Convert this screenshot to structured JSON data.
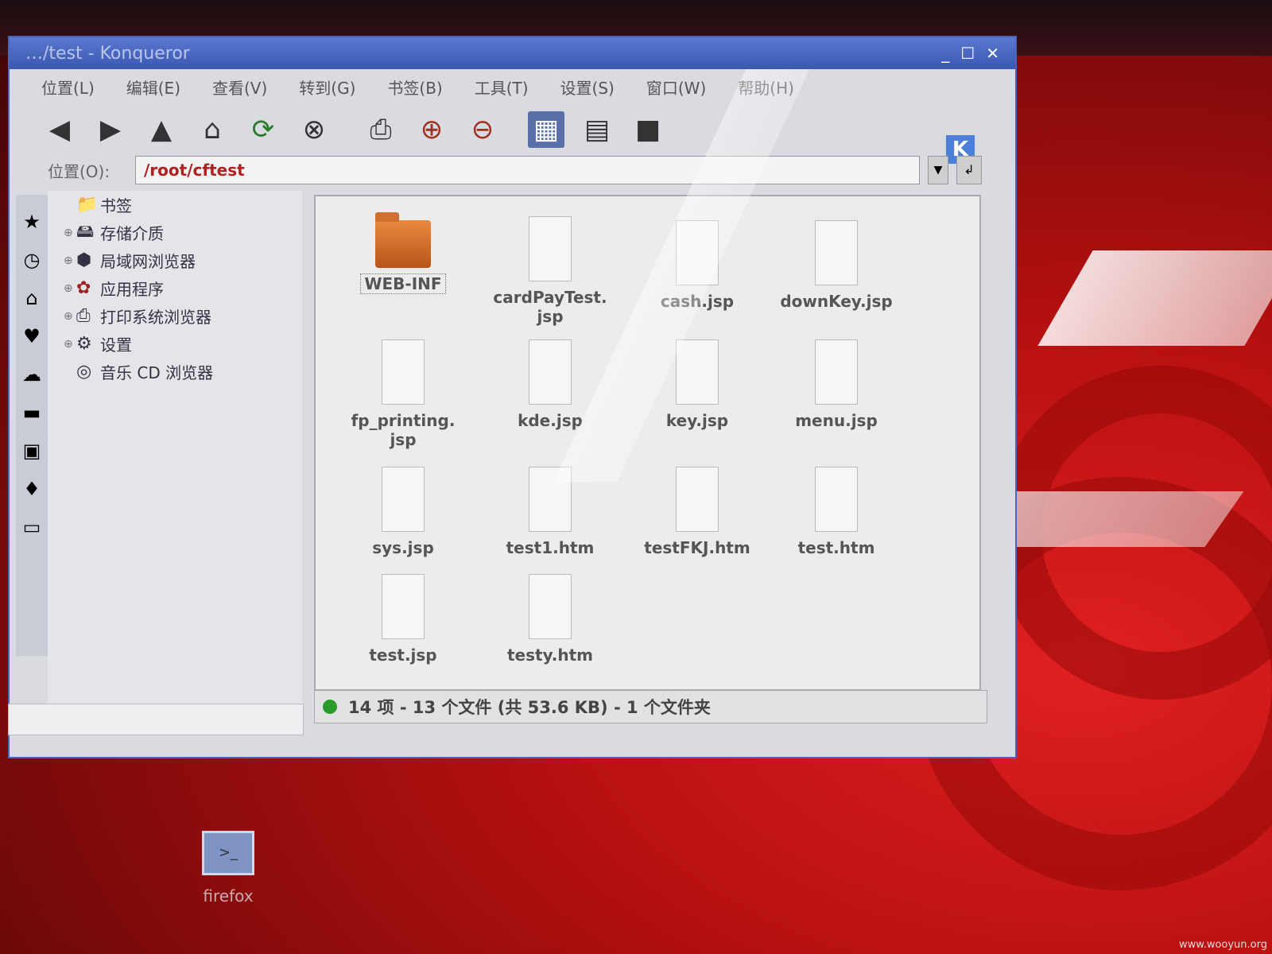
{
  "window": {
    "title": "…/test - Konqueror",
    "controls": [
      "_",
      "☐",
      "✕"
    ]
  },
  "menubar": [
    "位置(L)",
    "编辑(E)",
    "查看(V)",
    "转到(G)",
    "书签(B)",
    "工具(T)",
    "设置(S)",
    "窗口(W)",
    "帮助(H)"
  ],
  "location": {
    "label": "位置(O):",
    "value": "/root/cftest"
  },
  "tree": [
    {
      "label": "书签",
      "icon": "bookmarks-icon"
    },
    {
      "label": "存储介质",
      "icon": "storage-icon"
    },
    {
      "label": "局域网浏览器",
      "icon": "lan-icon"
    },
    {
      "label": "应用程序",
      "icon": "applications-icon"
    },
    {
      "label": "打印系统浏览器",
      "icon": "printer-icon"
    },
    {
      "label": "设置",
      "icon": "settings-icon"
    },
    {
      "label": "音乐 CD 浏览器",
      "icon": "cd-icon"
    }
  ],
  "files": [
    {
      "name": "WEB-INF",
      "type": "folder"
    },
    {
      "name": "cardPayTest.\njsp",
      "type": "file"
    },
    {
      "name": "cash.jsp",
      "type": "file"
    },
    {
      "name": "downKey.jsp",
      "type": "file"
    },
    {
      "name": "fp_printing.\njsp",
      "type": "file"
    },
    {
      "name": "kde.jsp",
      "type": "file"
    },
    {
      "name": "key.jsp",
      "type": "file"
    },
    {
      "name": "menu.jsp",
      "type": "file"
    },
    {
      "name": "sys.jsp",
      "type": "file"
    },
    {
      "name": "test1.htm",
      "type": "file"
    },
    {
      "name": "testFKJ.htm",
      "type": "file"
    },
    {
      "name": "test.htm",
      "type": "file"
    },
    {
      "name": "test.jsp",
      "type": "file"
    },
    {
      "name": "testy.htm",
      "type": "file"
    }
  ],
  "status": "14 项 - 13 个文件 (共 53.6 KB) - 1 个文件夹",
  "desktop": {
    "icon_label": "firefox"
  },
  "watermark": "www.wooyun.org"
}
